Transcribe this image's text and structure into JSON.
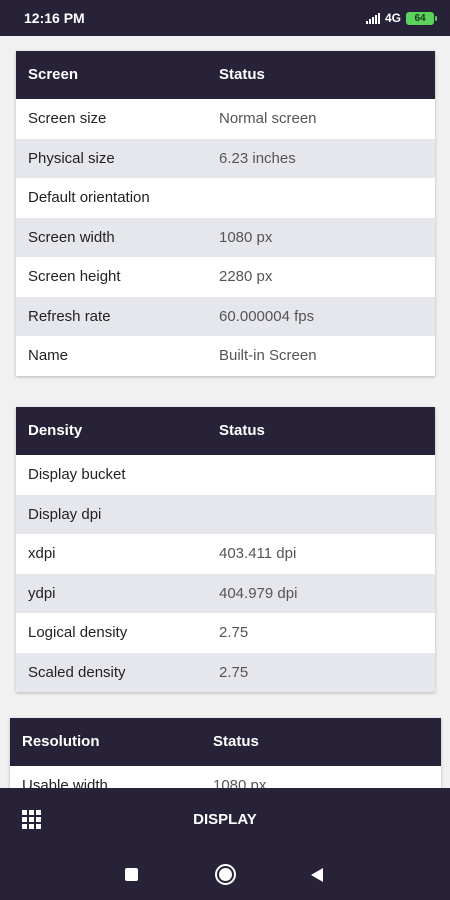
{
  "status_bar": {
    "time": "12:16 PM",
    "network": "4G",
    "battery": "64"
  },
  "cards": [
    {
      "header": [
        "Screen",
        "Status"
      ],
      "rows": [
        [
          "Screen size",
          "Normal screen"
        ],
        [
          "Physical size",
          "6.23 inches"
        ],
        [
          "Default orientation",
          ""
        ],
        [
          "Screen width",
          "1080 px"
        ],
        [
          "Screen height",
          "2280 px"
        ],
        [
          "Refresh rate",
          "60.000004 fps"
        ],
        [
          "Name",
          "Built-in Screen"
        ]
      ]
    },
    {
      "header": [
        "Density",
        "Status"
      ],
      "rows": [
        [
          "Display bucket",
          ""
        ],
        [
          "Display dpi",
          ""
        ],
        [
          "xdpi",
          "403.411 dpi"
        ],
        [
          "ydpi",
          "404.979 dpi"
        ],
        [
          "Logical density",
          "2.75"
        ],
        [
          "Scaled density",
          "2.75"
        ]
      ]
    },
    {
      "header": [
        "Resolution",
        "Status"
      ],
      "rows": [
        [
          "Usable width",
          "1080 px"
        ]
      ]
    }
  ],
  "bottom_bar": {
    "title": "DISPLAY",
    "menu_icon": "grid-menu-icon"
  }
}
